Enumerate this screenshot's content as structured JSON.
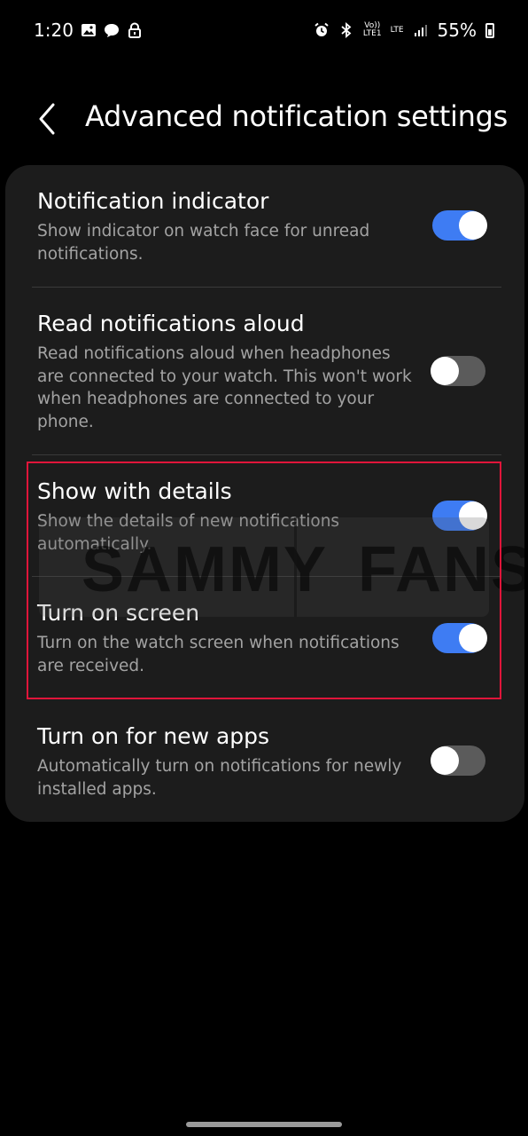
{
  "status_bar": {
    "time": "1:20",
    "left_icons": [
      "gallery-icon",
      "chat-icon",
      "lock-icon"
    ],
    "right_icons": [
      "alarm-icon",
      "bluetooth-icon",
      "volte-icon",
      "lte-icon",
      "signal-icon",
      "battery-icon"
    ],
    "volte_label": "Vo))\nLTE1",
    "lte_label": "LTE",
    "battery_percent": "55%"
  },
  "header": {
    "back_icon": "chevron-left-icon",
    "title": "Advanced notification settings"
  },
  "settings": [
    {
      "title": "Notification indicator",
      "description": "Show indicator on watch face for unread notifications.",
      "enabled": true
    },
    {
      "title": "Read notifications aloud",
      "description": "Read notifications aloud when headphones are connected to your watch. This won't work when headphones are connected to your phone.",
      "enabled": false
    },
    {
      "title": "Show with details",
      "description": "Show the details of new notifications automatically.",
      "enabled": true
    },
    {
      "title": "Turn on screen",
      "description": "Turn on the watch screen when notifications are received.",
      "enabled": true
    },
    {
      "title": "Turn on for new apps",
      "description": "Automatically turn on notifications for newly installed apps.",
      "enabled": false
    }
  ],
  "watermark": {
    "left": "SAMMY",
    "right": "FANS"
  },
  "colors": {
    "background": "#000000",
    "card": "#1c1c1c",
    "toggle_on": "#3e7cf3",
    "toggle_off": "#5b5b5b",
    "highlight": "#e0153a",
    "secondary_text": "#a3a3a3"
  }
}
